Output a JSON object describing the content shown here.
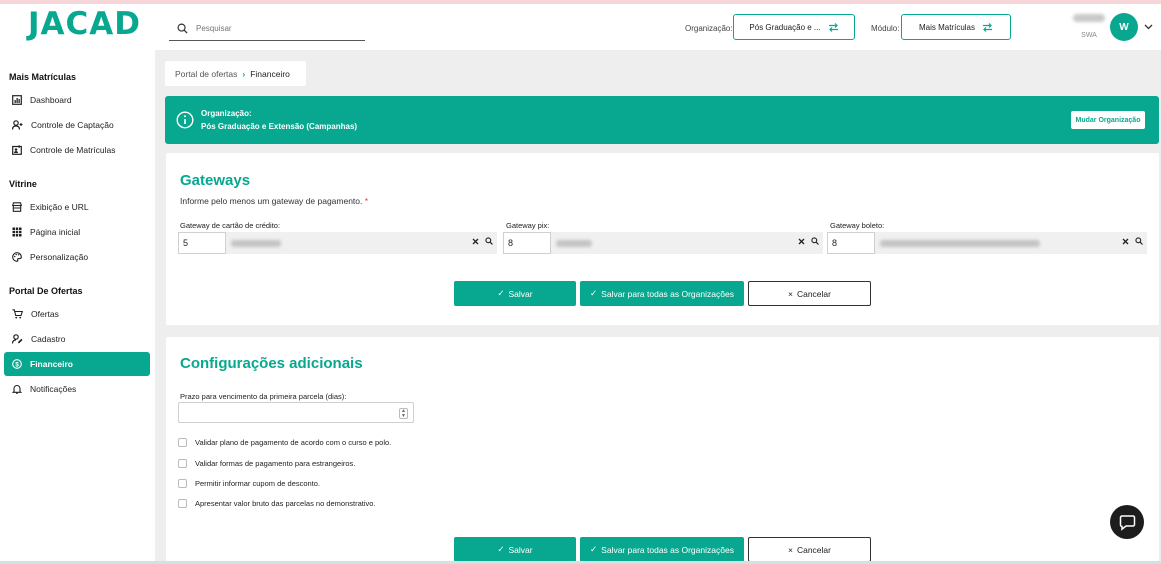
{
  "brand": {
    "logo": "JACAD",
    "accent": "#07a88f"
  },
  "header": {
    "search_placeholder": "Pesquisar",
    "org_label": "Organização:",
    "org_value": "Pós Graduação e ...",
    "module_label": "Módulo:",
    "module_value": "Mais Matrículas",
    "user_role": "SWA",
    "user_initial": "W"
  },
  "sidebar": {
    "sections": [
      {
        "title": "Mais Matrículas",
        "items": [
          {
            "label": "Dashboard",
            "icon": "dashboard-icon"
          },
          {
            "label": "Controle de Captação",
            "icon": "user-add-icon"
          },
          {
            "label": "Controle de Matrículas",
            "icon": "enrollment-icon"
          }
        ]
      },
      {
        "title": "Vitrine",
        "items": [
          {
            "label": "Exibição e URL",
            "icon": "storefront-icon"
          },
          {
            "label": "Página inicial",
            "icon": "grid-icon"
          },
          {
            "label": "Personalização",
            "icon": "palette-icon"
          }
        ]
      },
      {
        "title": "Portal De Ofertas",
        "items": [
          {
            "label": "Ofertas",
            "icon": "cart-icon"
          },
          {
            "label": "Cadastro",
            "icon": "user-edit-icon"
          },
          {
            "label": "Financeiro",
            "icon": "dollar-icon",
            "active": true
          },
          {
            "label": "Notificações",
            "icon": "bell-icon"
          }
        ]
      }
    ]
  },
  "breadcrumb": {
    "parent": "Portal de ofertas",
    "current": "Financeiro"
  },
  "banner": {
    "title": "Organização:",
    "org_name": "Pós Graduação e Extensão (Campanhas)",
    "button": "Mudar Organização"
  },
  "gateways": {
    "title": "Gateways",
    "hint": "Informe pelo menos um gateway de pagamento.",
    "required_mark": "*",
    "fields": [
      {
        "label": "Gateway de cartão de crédito:",
        "code": "5"
      },
      {
        "label": "Gateway pix:",
        "code": "8"
      },
      {
        "label": "Gateway boleto:",
        "code": "8"
      }
    ]
  },
  "actions": {
    "save": "Salvar",
    "save_all": "Salvar para todas as Organizações",
    "cancel": "Cancelar"
  },
  "additional": {
    "title": "Configurações adicionais",
    "due_label": "Prazo para vencimento da primeira parcela (dias):",
    "due_value": "",
    "checks": [
      {
        "label": "Validar plano de pagamento de acordo com o curso e polo.",
        "checked": false
      },
      {
        "label": "Validar formas de pagamento para estrangeiros.",
        "checked": false
      },
      {
        "label": "Permitir informar cupom de desconto.",
        "checked": false
      },
      {
        "label": "Apresentar valor bruto das parcelas no demonstrativo.",
        "checked": false
      }
    ]
  }
}
